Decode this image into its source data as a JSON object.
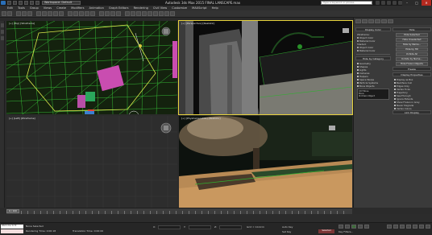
{
  "app": {
    "title": "Autodesk 3ds Max 2015   FINAL LANSCAPE.max",
    "workspace": "Workspace: Default",
    "search_placeholder": "Type a keyword or phrase",
    "window_buttons": [
      "–",
      "□",
      "✕"
    ]
  },
  "menu": [
    "Edit",
    "Tools",
    "Group",
    "Views",
    "Create",
    "Modifiers",
    "Animation",
    "Graph Editors",
    "Rendering",
    "Civil View",
    "Customize",
    "MAXScript",
    "Help"
  ],
  "viewports": {
    "top_left": "[+] [Top] [Wireframe]",
    "top_right": "[+] [Perspective] [Realistic]",
    "bottom_left": "[+] [Left] [Wireframe]",
    "bottom_right": "[+] [PhysCamera001] [Realistic]"
  },
  "command_panel": {
    "display_color": {
      "title": "Display Color",
      "wireframe_label": "Wireframe:",
      "shaded_label": "Shaded:",
      "object_color": "Object Color",
      "material_color": "Material Color"
    },
    "hide_by_category": {
      "title": "Hide by Category",
      "items": [
        "Geometry",
        "Shapes",
        "Lights",
        "Cameras",
        "Helpers",
        "Space Warps",
        "Particle Systems",
        "Bone Objects"
      ],
      "all_label": "All",
      "none_label": "None",
      "invert_label": "Invert",
      "list_items": [
        "CAT Bone",
        "Bone",
        "IK Chain Object",
        "Point"
      ],
      "add_label": "Add",
      "remove_label": "Remove",
      "none_button": "None"
    },
    "hide": {
      "title": "Hide",
      "buttons": [
        "Hide Selected",
        "Hide Unselected",
        "Hide by Name...",
        "Hide by Hit",
        "Unhide All",
        "Unhide by Name...",
        "Hide Frozen Objects"
      ]
    },
    "freeze": {
      "title": "Freeze"
    },
    "display_properties": {
      "title": "Display Properties",
      "items": [
        "Display as Box",
        "Backface Cull",
        "Edges Only",
        "Vertex Ticks",
        "Trajectory",
        "See-Through",
        "Ignore Extents",
        "Show Frozen in Gray",
        "Never Degrade",
        "Vertex Colors"
      ]
    },
    "link_display": {
      "title": "Link Display"
    }
  },
  "timeline": {
    "frame_label": "0 / 100",
    "tick_labels": [
      "0",
      "10",
      "20",
      "30",
      "40",
      "50",
      "60",
      "70",
      "80",
      "90",
      "100"
    ]
  },
  "status": {
    "maxscript_line1": "Welcome to M",
    "maxscript_line2": "",
    "selection": "None Selected",
    "prompt": "Rendering Time: 0:00:18",
    "translation": "Translation Time: 0:00:00",
    "x_label": "X:",
    "y_label": "Y:",
    "z_label": "Z:",
    "grid": "Grid = 10.0cm",
    "auto_key": "Auto Key",
    "set_key": "Set Key",
    "selected": "Selected",
    "key_filters": "Key Filters..."
  }
}
